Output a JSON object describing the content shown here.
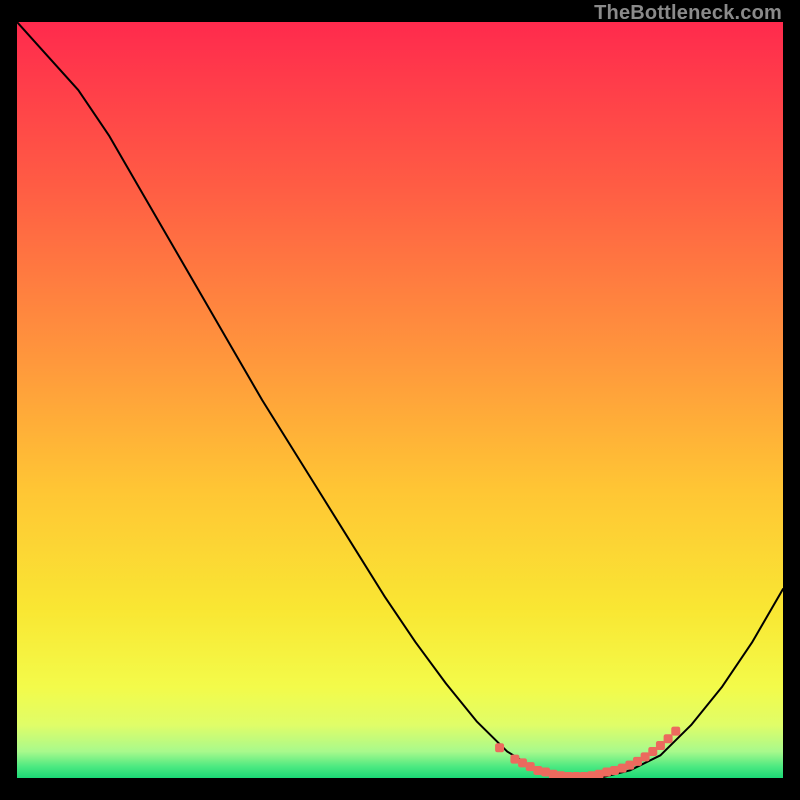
{
  "watermark": "TheBottleneck.com",
  "chart_data": {
    "type": "line",
    "title": "",
    "xlabel": "",
    "ylabel": "",
    "xlim": [
      0,
      100
    ],
    "ylim": [
      0,
      100
    ],
    "grid": false,
    "series": [
      {
        "name": "bottleneck-curve",
        "color": "#000000",
        "x": [
          0,
          4,
          8,
          12,
          16,
          20,
          24,
          28,
          32,
          36,
          40,
          44,
          48,
          52,
          56,
          60,
          64,
          68,
          72,
          76,
          80,
          84,
          88,
          92,
          96,
          100
        ],
        "y": [
          100,
          95.5,
          91,
          85,
          78,
          71,
          64,
          57,
          50,
          43.5,
          37,
          30.5,
          24,
          18,
          12.5,
          7.5,
          3.5,
          1,
          0,
          0,
          1,
          3,
          7,
          12,
          18,
          25
        ]
      },
      {
        "name": "optimal-markers",
        "color": "#EC6A5E",
        "x": [
          63,
          65,
          66,
          67,
          68,
          69,
          70,
          71,
          72,
          73,
          74,
          75,
          76,
          77,
          78,
          79,
          80,
          81,
          82,
          83,
          84,
          85,
          86
        ],
        "y": [
          4,
          2.5,
          2,
          1.5,
          1,
          0.8,
          0.5,
          0.3,
          0.2,
          0.2,
          0.2,
          0.3,
          0.5,
          0.8,
          1,
          1.3,
          1.7,
          2.2,
          2.8,
          3.5,
          4.3,
          5.2,
          6.2
        ]
      }
    ],
    "background_gradient": {
      "stops": [
        {
          "offset": 0.0,
          "color": "#FF2A4D"
        },
        {
          "offset": 0.22,
          "color": "#FF5D44"
        },
        {
          "offset": 0.45,
          "color": "#FF983C"
        },
        {
          "offset": 0.62,
          "color": "#FFC634"
        },
        {
          "offset": 0.78,
          "color": "#F9E733"
        },
        {
          "offset": 0.88,
          "color": "#F3FB4A"
        },
        {
          "offset": 0.93,
          "color": "#E0FD68"
        },
        {
          "offset": 0.965,
          "color": "#A8F98C"
        },
        {
          "offset": 0.985,
          "color": "#4CE981"
        },
        {
          "offset": 1.0,
          "color": "#1BD876"
        }
      ]
    }
  }
}
